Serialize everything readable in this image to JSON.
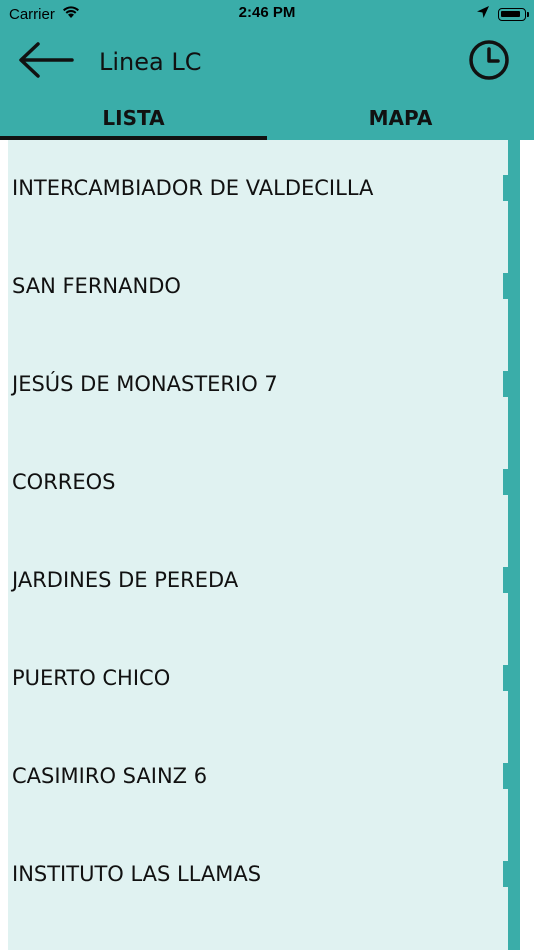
{
  "status_bar": {
    "carrier": "Carrier",
    "time": "2:46 PM"
  },
  "header": {
    "title": "Linea LC",
    "back_icon": "arrow-left-icon",
    "history_icon": "clock-icon"
  },
  "tabs": [
    {
      "label": "LISTA",
      "active": true
    },
    {
      "label": "MAPA",
      "active": false
    }
  ],
  "stops": [
    {
      "name": "INTERCAMBIADOR DE VALDECILLA"
    },
    {
      "name": "SAN FERNANDO"
    },
    {
      "name": "JESÚS DE MONASTERIO 7"
    },
    {
      "name": "CORREOS"
    },
    {
      "name": "JARDINES DE PEREDA"
    },
    {
      "name": "PUERTO CHICO"
    },
    {
      "name": "CASIMIRO SAINZ 6"
    },
    {
      "name": "INSTITUTO LAS LLAMAS"
    }
  ],
  "colors": {
    "primary": "#3aada9",
    "list_background": "#e0f2f1",
    "text": "#111111"
  }
}
